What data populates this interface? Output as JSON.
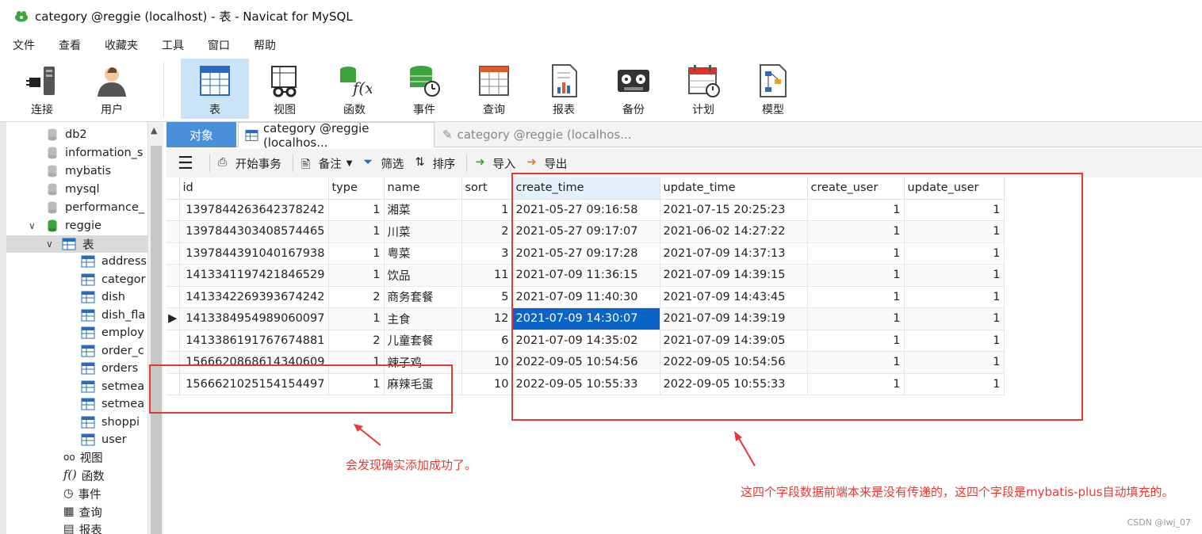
{
  "window": {
    "title": "category @reggie (localhost) - 表 - Navicat for MySQL"
  },
  "menu": [
    "文件",
    "查看",
    "收藏夹",
    "工具",
    "窗口",
    "帮助"
  ],
  "toolbar": [
    "连接",
    "用户",
    "表",
    "视图",
    "函数",
    "事件",
    "查询",
    "报表",
    "备份",
    "计划",
    "模型"
  ],
  "sidebar": {
    "databases": [
      "db2",
      "information_s",
      "mybatis",
      "mysql",
      "performance_",
      "reggie"
    ],
    "tables_group": "表",
    "tables": [
      "address",
      "categor",
      "dish",
      "dish_fla",
      "employ",
      "order_c",
      "orders",
      "setmea",
      "setmea",
      "shoppi",
      "user"
    ],
    "other": [
      "视图",
      "函数",
      "事件",
      "查询",
      "报表"
    ]
  },
  "tabs": {
    "objects": "对象",
    "tab1": "category @reggie (localhos...",
    "tab2": "category @reggie (localhos..."
  },
  "actions": {
    "begin": "开始事务",
    "note": "备注",
    "filter": "筛选",
    "sort": "排序",
    "import": "导入",
    "export": "导出"
  },
  "grid": {
    "columns": [
      "id",
      "type",
      "name",
      "sort",
      "create_time",
      "update_time",
      "create_user",
      "update_user"
    ],
    "rows": [
      [
        "1397844263642378242",
        "1",
        "湘菜",
        "1",
        "2021-05-27 09:16:58",
        "2021-07-15 20:25:23",
        "1",
        "1"
      ],
      [
        "1397844303408574465",
        "1",
        "川菜",
        "2",
        "2021-05-27 09:17:07",
        "2021-06-02 14:27:22",
        "1",
        "1"
      ],
      [
        "1397844391040167938",
        "1",
        "粤菜",
        "3",
        "2021-05-27 09:17:28",
        "2021-07-09 14:37:13",
        "1",
        "1"
      ],
      [
        "1413341197421846529",
        "1",
        "饮品",
        "11",
        "2021-07-09 11:36:15",
        "2021-07-09 14:39:15",
        "1",
        "1"
      ],
      [
        "1413342269393674242",
        "2",
        "商务套餐",
        "5",
        "2021-07-09 11:40:30",
        "2021-07-09 14:43:45",
        "1",
        "1"
      ],
      [
        "1413384954989060097",
        "1",
        "主食",
        "12",
        "2021-07-09 14:30:07",
        "2021-07-09 14:39:19",
        "1",
        "1"
      ],
      [
        "1413386191767674881",
        "2",
        "儿童套餐",
        "6",
        "2021-07-09 14:35:02",
        "2021-07-09 14:39:05",
        "1",
        "1"
      ],
      [
        "1566620868614340609",
        "1",
        "辣子鸡",
        "10",
        "2022-09-05 10:54:56",
        "2022-09-05 10:54:56",
        "1",
        "1"
      ],
      [
        "1566621025154154497",
        "1",
        "麻辣毛蛋",
        "10",
        "2022-09-05 10:55:33",
        "2022-09-05 10:55:33",
        "1",
        "1"
      ]
    ],
    "current_row": 5,
    "selected_cell": {
      "row": 5,
      "col": 4
    }
  },
  "annotations": {
    "note_left": "会发现确实添加成功了。",
    "note_right": "这四个字段数据前端本来是没有传递的，这四个字段是mybatis-plus自动填充的。"
  },
  "watermark": "CSDN @lwj_07",
  "colors": {
    "annotation": "#e53935",
    "selection": "#0a64c8",
    "active_tool": "#cce4f7",
    "objects_tab": "#4a90d9"
  }
}
